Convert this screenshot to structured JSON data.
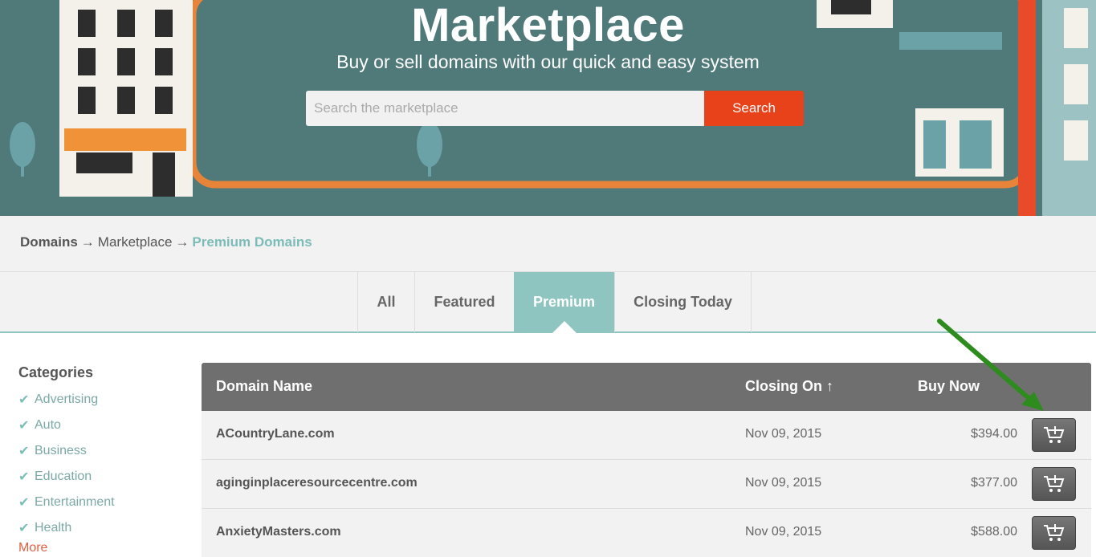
{
  "hero": {
    "title": "Marketplace",
    "subtitle": "Buy or sell domains with our quick and easy system",
    "search_placeholder": "Search the marketplace",
    "search_button": "Search"
  },
  "breadcrumb": {
    "items": [
      "Domains",
      "Marketplace",
      "Premium Domains"
    ],
    "separator": "→"
  },
  "tabs": [
    {
      "label": "All",
      "active": false
    },
    {
      "label": "Featured",
      "active": false
    },
    {
      "label": "Premium",
      "active": true
    },
    {
      "label": "Closing Today",
      "active": false
    }
  ],
  "sidebar": {
    "heading": "Categories",
    "categories": [
      "Advertising",
      "Auto",
      "Business",
      "Education",
      "Entertainment",
      "Health"
    ],
    "more_label": "More"
  },
  "table": {
    "headers": {
      "domain": "Domain Name",
      "closing": "Closing On ↑",
      "buy": "Buy Now"
    },
    "rows": [
      {
        "domain": "ACountryLane.com",
        "closing": "Nov 09, 2015",
        "price": "$394.00"
      },
      {
        "domain": "aginginplaceresourcecentre.com",
        "closing": "Nov 09, 2015",
        "price": "$377.00"
      },
      {
        "domain": "AnxietyMasters.com",
        "closing": "Nov 09, 2015",
        "price": "$588.00"
      }
    ]
  },
  "colors": {
    "accent": "#8ec5c1",
    "search_button": "#e8421b",
    "header_bg": "#6f6f6f",
    "annotation_arrow": "#2e8b1e"
  },
  "icons": [
    "cart-icon",
    "checkmark-icon",
    "sort-arrow-icon"
  ]
}
